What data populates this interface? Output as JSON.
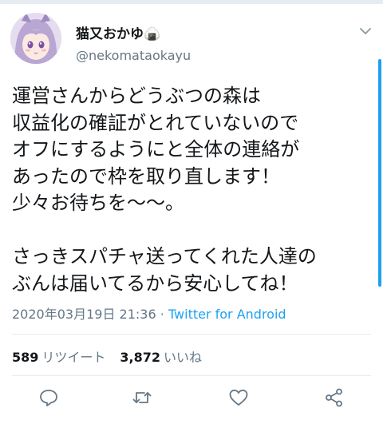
{
  "author": {
    "display_name": "猫又おかゆ🍙",
    "handle": "@nekomataokayu",
    "avatar_icon": "avatar-girl-icon"
  },
  "tweet": {
    "lines": [
      "運営さんからどうぶつの森は",
      "収益化の確証がとれていないので",
      "オフにするようにと全体の連絡が",
      "あったので枠を取り直します！",
      "少々お待ちを〜〜。",
      "",
      "さっきスパチャ送ってくれた人達の",
      "ぶんは届いてるから安心してね！"
    ],
    "timestamp": "2020年03月19日 21:36",
    "separator": " · ",
    "source": "Twitter for Android"
  },
  "stats": {
    "retweets_count": "589",
    "retweets_label": "リツイート",
    "likes_count": "3,872",
    "likes_label": "いいね"
  },
  "actions": [
    "reply-icon",
    "retweet-icon",
    "like-icon",
    "share-icon"
  ],
  "colors": {
    "accent": "#1da1f2",
    "text": "#14171a",
    "muted": "#657786",
    "divider": "#e6ecf0"
  }
}
